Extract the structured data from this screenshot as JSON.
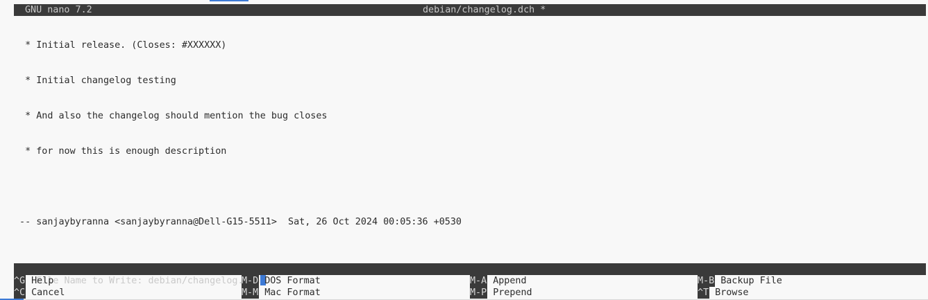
{
  "title_bar": {
    "app": "GNU nano 7.2",
    "file": "debian/changelog.dch *"
  },
  "editor": {
    "lines": [
      "  * Initial release. (Closes: #XXXXXX)",
      "  * Initial changelog testing",
      "  * And also the changelog should mention the bug closes",
      "  * for now this is enough description",
      "",
      " -- sanjaybyranna <sanjaybyranna@Dell-G15-5511>  Sat, 26 Oct 2024 00:05:36 +0530"
    ]
  },
  "prompt": {
    "label": "File Name to Write: ",
    "value": "debian/changelog.dch"
  },
  "shortcuts": [
    {
      "key": "^G",
      "label": "Help"
    },
    {
      "key": "M-D",
      "label": "DOS Format"
    },
    {
      "key": "M-A",
      "label": "Append"
    },
    {
      "key": "M-B",
      "label": "Backup File"
    },
    {
      "key": "^C",
      "label": "Cancel"
    },
    {
      "key": "M-M",
      "label": "Mac Format"
    },
    {
      "key": "M-P",
      "label": "Prepend"
    },
    {
      "key": "^T",
      "label": "Browse"
    }
  ],
  "colors": {
    "background": "#f8f8f8",
    "bar": "#3a3a3a",
    "cursor": "#3d7ad6"
  }
}
